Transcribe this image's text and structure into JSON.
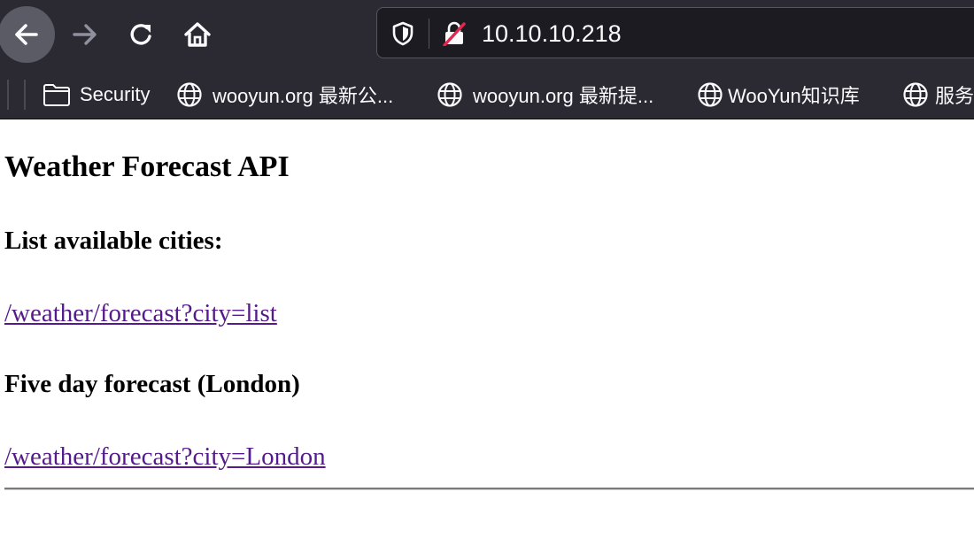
{
  "browser": {
    "url": "10.10.10.218",
    "bookmarks": [
      {
        "label": "Security",
        "icon": "folder-icon"
      },
      {
        "label": "wooyun.org 最新公...",
        "icon": "globe-icon"
      },
      {
        "label": "wooyun.org 最新提...",
        "icon": "globe-icon"
      },
      {
        "label": "WooYun知识库",
        "icon": "globe-icon"
      },
      {
        "label": "服务",
        "icon": "globe-icon"
      }
    ]
  },
  "page": {
    "title": "Weather Forecast API",
    "section_cities": {
      "heading": "List available cities:",
      "link": "/weather/forecast?city=list"
    },
    "section_london": {
      "heading": "Five day forecast (London)",
      "link": "/weather/forecast?city=London"
    }
  },
  "colors": {
    "chrome_bg": "#2b2a33",
    "urlbar_bg": "#1c1b22",
    "visited_link": "#551a8b"
  }
}
